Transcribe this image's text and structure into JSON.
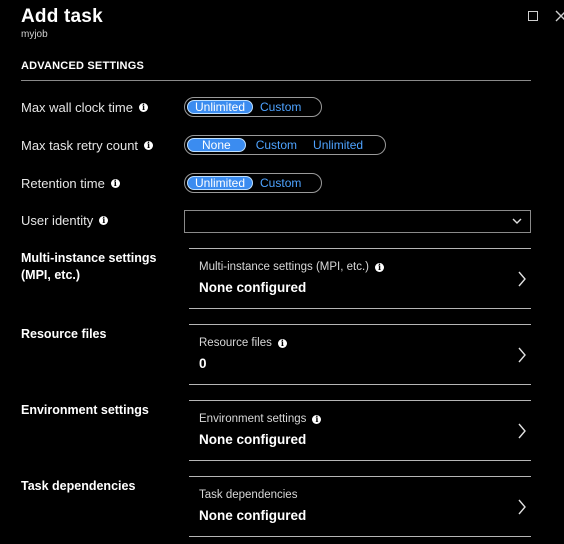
{
  "window": {
    "title": "Add task",
    "subtitle": "myjob"
  },
  "section": {
    "title": "ADVANCED SETTINGS"
  },
  "settings": {
    "max_wall_clock": {
      "label": "Max wall clock time",
      "options": [
        "Unlimited",
        "Custom"
      ],
      "selected": "Unlimited"
    },
    "max_retry": {
      "label": "Max task retry count",
      "options": [
        "None",
        "Custom",
        "Unlimited"
      ],
      "selected": "None"
    },
    "retention": {
      "label": "Retention time",
      "options": [
        "Unlimited",
        "Custom"
      ],
      "selected": "Unlimited"
    },
    "user_identity": {
      "label": "User identity",
      "value": ""
    }
  },
  "groups": {
    "multi_instance": {
      "label": "Multi-instance settings (MPI, etc.)",
      "card_title": "Multi-instance settings (MPI, etc.)",
      "value": "None configured"
    },
    "resource_files": {
      "label": "Resource files",
      "card_title": "Resource files",
      "value": "0"
    },
    "environment": {
      "label": "Environment settings",
      "card_title": "Environment settings",
      "value": "None configured"
    },
    "dependencies": {
      "label": "Task dependencies",
      "card_title": "Task dependencies",
      "value": "None configured"
    }
  }
}
